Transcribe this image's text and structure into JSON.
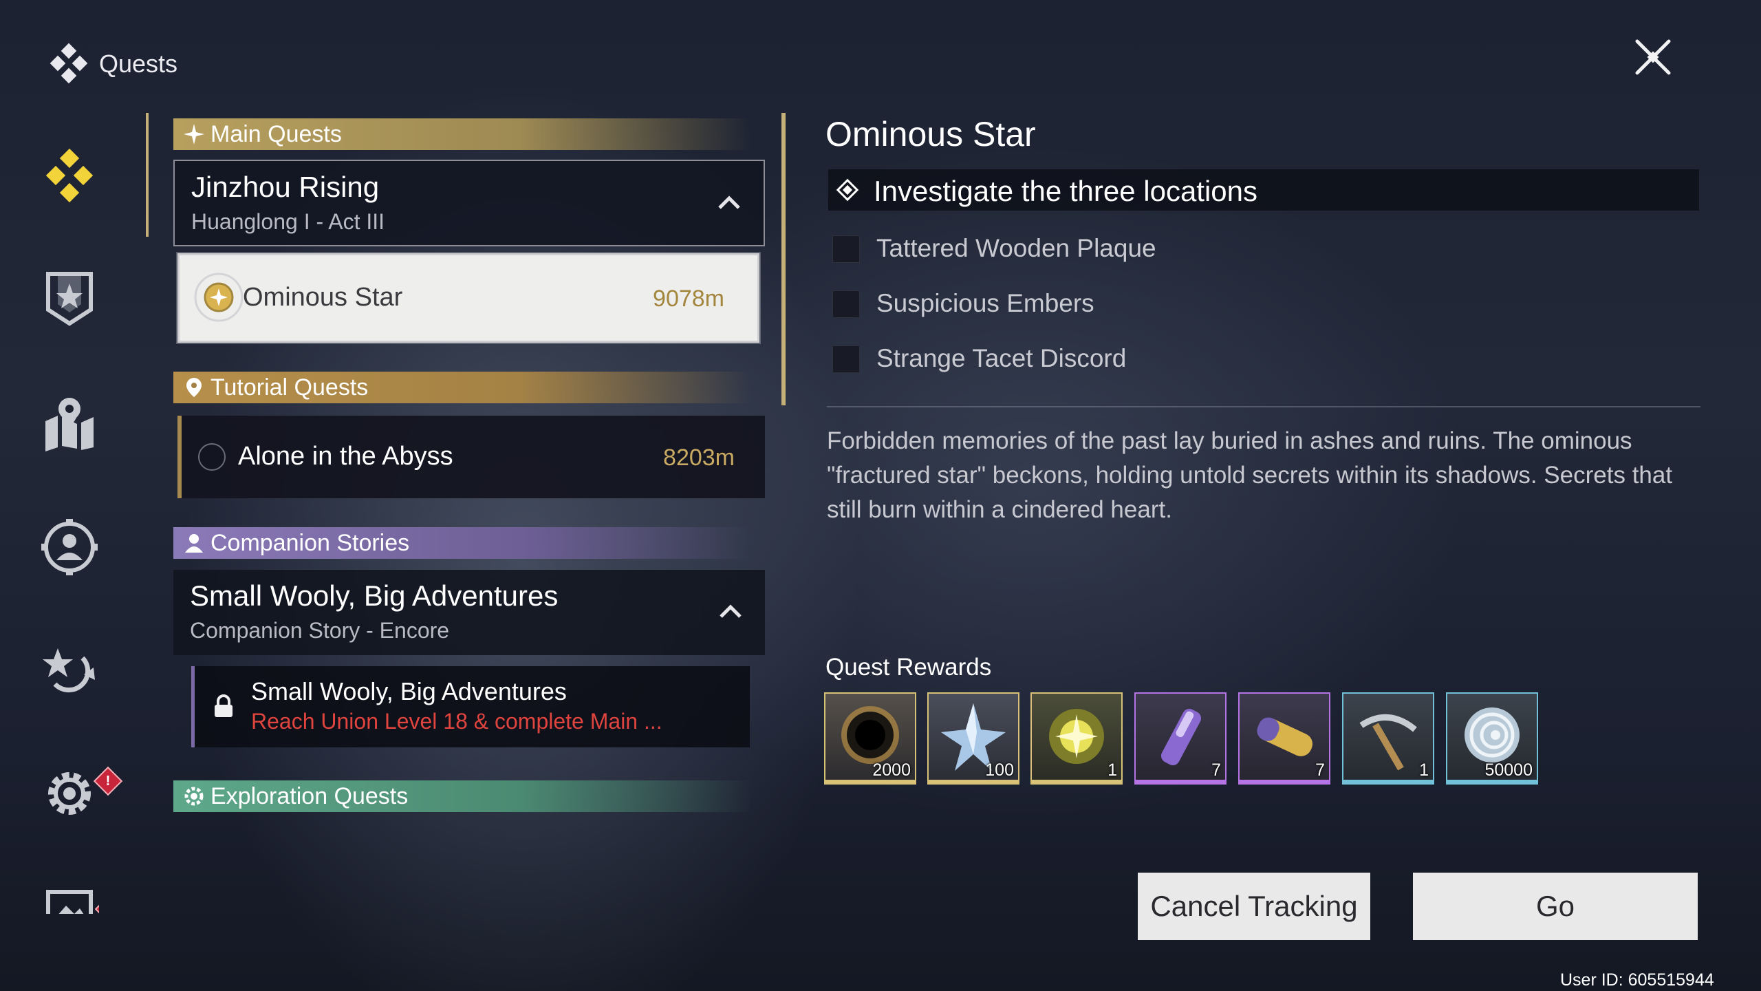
{
  "header": {
    "title": "Quests",
    "logo_icon": "quest-diamond-icon",
    "close_icon": "close-icon"
  },
  "nav": [
    {
      "name": "quests",
      "icon": "quest-diamond-icon",
      "active": true
    },
    {
      "name": "bounties",
      "icon": "shield-star-icon"
    },
    {
      "name": "map",
      "icon": "map-pin-icon"
    },
    {
      "name": "character",
      "icon": "person-circle-icon"
    },
    {
      "name": "rewards",
      "icon": "star-refresh-icon"
    },
    {
      "name": "settings",
      "icon": "gear-icon",
      "badge": "!"
    },
    {
      "name": "screen",
      "icon": "monitor-icon",
      "badge": "!"
    }
  ],
  "quest_list": {
    "main": {
      "category_label": "Main Quests",
      "group_title": "Jinzhou Rising",
      "group_subtitle": "Huanglong I - Act III",
      "selected_quest": {
        "title": "Ominous Star",
        "distance": "9078m"
      }
    },
    "tutorial": {
      "category_label": "Tutorial Quests",
      "quest": {
        "title": "Alone in the Abyss",
        "distance": "8203m"
      }
    },
    "companion": {
      "category_label": "Companion Stories",
      "group_title": "Small Wooly, Big Adventures",
      "group_subtitle": "Companion Story - Encore",
      "locked_quest": {
        "title": "Small Wooly, Big Adventures",
        "requirement": "Reach Union Level 18 & complete Main ..."
      }
    },
    "exploration": {
      "category_label": "Exploration Quests"
    }
  },
  "detail": {
    "title": "Ominous Star",
    "objective": "Investigate the three locations",
    "sub_objectives": [
      "Tattered Wooden Plaque",
      "Suspicious Embers",
      "Strange Tacet Discord"
    ],
    "description": "Forbidden memories of the past lay buried in ashes and ruins. The ominous \"fractured star\" beckons, holding untold secrets within its shadows. Secrets that still burn within a cindered heart.",
    "rewards_title": "Quest Rewards",
    "rewards": [
      {
        "icon": "dark-ring-icon",
        "qty": "2000",
        "rarity_color": "#d8c277"
      },
      {
        "icon": "crystal-star-icon",
        "qty": "100",
        "rarity_color": "#d8c277"
      },
      {
        "icon": "golden-sun-icon",
        "qty": "1",
        "rarity_color": "#d8c277"
      },
      {
        "icon": "purple-vial-icon",
        "qty": "7",
        "rarity_color": "#b574e6"
      },
      {
        "icon": "golden-capsule-icon",
        "qty": "7",
        "rarity_color": "#b574e6"
      },
      {
        "icon": "pickaxe-icon",
        "qty": "1",
        "rarity_color": "#71c1d8"
      },
      {
        "icon": "shell-coin-icon",
        "qty": "50000",
        "rarity_color": "#71c1d8"
      }
    ],
    "cancel_label": "Cancel Tracking",
    "go_label": "Go"
  },
  "footer": {
    "user_id": "User ID: 605515944"
  }
}
